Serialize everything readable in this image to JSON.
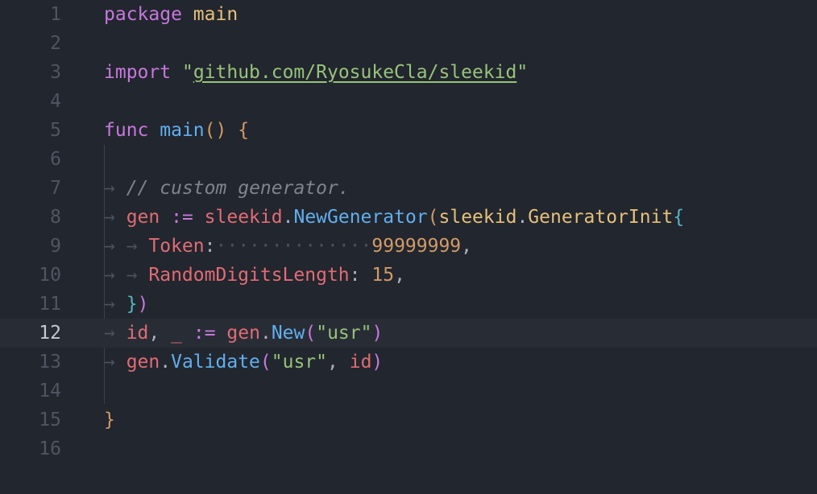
{
  "editor": {
    "active_line": 12,
    "lines": [
      {
        "n": "1",
        "tokens": [
          {
            "t": "package",
            "c": "kw"
          },
          {
            "t": " ",
            "c": "ws"
          },
          {
            "t": "main",
            "c": "type"
          }
        ]
      },
      {
        "n": "2",
        "tokens": []
      },
      {
        "n": "3",
        "tokens": [
          {
            "t": "import",
            "c": "kw"
          },
          {
            "t": " ",
            "c": "ws"
          },
          {
            "t": "\"",
            "c": "str"
          },
          {
            "t": "github.com/RyosukeCla/sleekid",
            "c": "url"
          },
          {
            "t": "\"",
            "c": "str"
          }
        ]
      },
      {
        "n": "4",
        "tokens": []
      },
      {
        "n": "5",
        "tokens": [
          {
            "t": "func",
            "c": "kw"
          },
          {
            "t": " ",
            "c": "ws"
          },
          {
            "t": "main",
            "c": "fn"
          },
          {
            "t": "()",
            "c": "paren"
          },
          {
            "t": " ",
            "c": "ws"
          },
          {
            "t": "{",
            "c": "paren"
          }
        ]
      },
      {
        "n": "6",
        "tokens": []
      },
      {
        "n": "7",
        "tokens": [
          {
            "t": "→ ",
            "c": "ws"
          },
          {
            "t": "//",
            "c": "com"
          },
          {
            "t": " ",
            "c": "ws"
          },
          {
            "t": "custom",
            "c": "com"
          },
          {
            "t": " ",
            "c": "ws"
          },
          {
            "t": "generator.",
            "c": "com"
          }
        ]
      },
      {
        "n": "8",
        "tokens": [
          {
            "t": "→ ",
            "c": "ws"
          },
          {
            "t": "gen",
            "c": "var"
          },
          {
            "t": " ",
            "c": "ws"
          },
          {
            "t": ":=",
            "c": "op"
          },
          {
            "t": " ",
            "c": "ws"
          },
          {
            "t": "sleekid",
            "c": "var"
          },
          {
            "t": ".",
            "c": "pl"
          },
          {
            "t": "NewGenerator",
            "c": "fn"
          },
          {
            "t": "(",
            "c": "paren"
          },
          {
            "t": "sleekid",
            "c": "type"
          },
          {
            "t": ".",
            "c": "pl"
          },
          {
            "t": "GeneratorInit",
            "c": "type"
          },
          {
            "t": "{",
            "c": "brace"
          }
        ]
      },
      {
        "n": "9",
        "tokens": [
          {
            "t": "→ → ",
            "c": "ws"
          },
          {
            "t": "Token",
            "c": "var"
          },
          {
            "t": ":",
            "c": "pl"
          },
          {
            "t": "··············",
            "c": "ws"
          },
          {
            "t": "99999999",
            "c": "num"
          },
          {
            "t": ",",
            "c": "pl"
          }
        ]
      },
      {
        "n": "10",
        "tokens": [
          {
            "t": "→ → ",
            "c": "ws"
          },
          {
            "t": "RandomDigitsLength",
            "c": "var"
          },
          {
            "t": ":",
            "c": "pl"
          },
          {
            "t": " ",
            "c": "ws"
          },
          {
            "t": "15",
            "c": "num"
          },
          {
            "t": ",",
            "c": "pl"
          }
        ]
      },
      {
        "n": "11",
        "tokens": [
          {
            "t": "→ ",
            "c": "ws"
          },
          {
            "t": "}",
            "c": "brace"
          },
          {
            "t": ")",
            "c": "purp"
          }
        ]
      },
      {
        "n": "12",
        "tokens": [
          {
            "t": "→ ",
            "c": "ws"
          },
          {
            "t": "id",
            "c": "var"
          },
          {
            "t": ",",
            "c": "pl"
          },
          {
            "t": " ",
            "c": "ws"
          },
          {
            "t": "_",
            "c": "var"
          },
          {
            "t": " ",
            "c": "ws"
          },
          {
            "t": ":=",
            "c": "op"
          },
          {
            "t": " ",
            "c": "ws"
          },
          {
            "t": "gen",
            "c": "var"
          },
          {
            "t": ".",
            "c": "pl"
          },
          {
            "t": "New",
            "c": "fn"
          },
          {
            "t": "(",
            "c": "purp"
          },
          {
            "t": "\"usr\"",
            "c": "str"
          },
          {
            "t": ")",
            "c": "purp"
          }
        ]
      },
      {
        "n": "13",
        "tokens": [
          {
            "t": "→ ",
            "c": "ws"
          },
          {
            "t": "gen",
            "c": "var"
          },
          {
            "t": ".",
            "c": "pl"
          },
          {
            "t": "Validate",
            "c": "fn"
          },
          {
            "t": "(",
            "c": "purp"
          },
          {
            "t": "\"usr\"",
            "c": "str"
          },
          {
            "t": ",",
            "c": "pl"
          },
          {
            "t": " ",
            "c": "ws"
          },
          {
            "t": "id",
            "c": "var"
          },
          {
            "t": ")",
            "c": "purp"
          }
        ]
      },
      {
        "n": "14",
        "tokens": []
      },
      {
        "n": "15",
        "tokens": [
          {
            "t": "}",
            "c": "paren"
          }
        ]
      },
      {
        "n": "16",
        "tokens": []
      }
    ]
  }
}
